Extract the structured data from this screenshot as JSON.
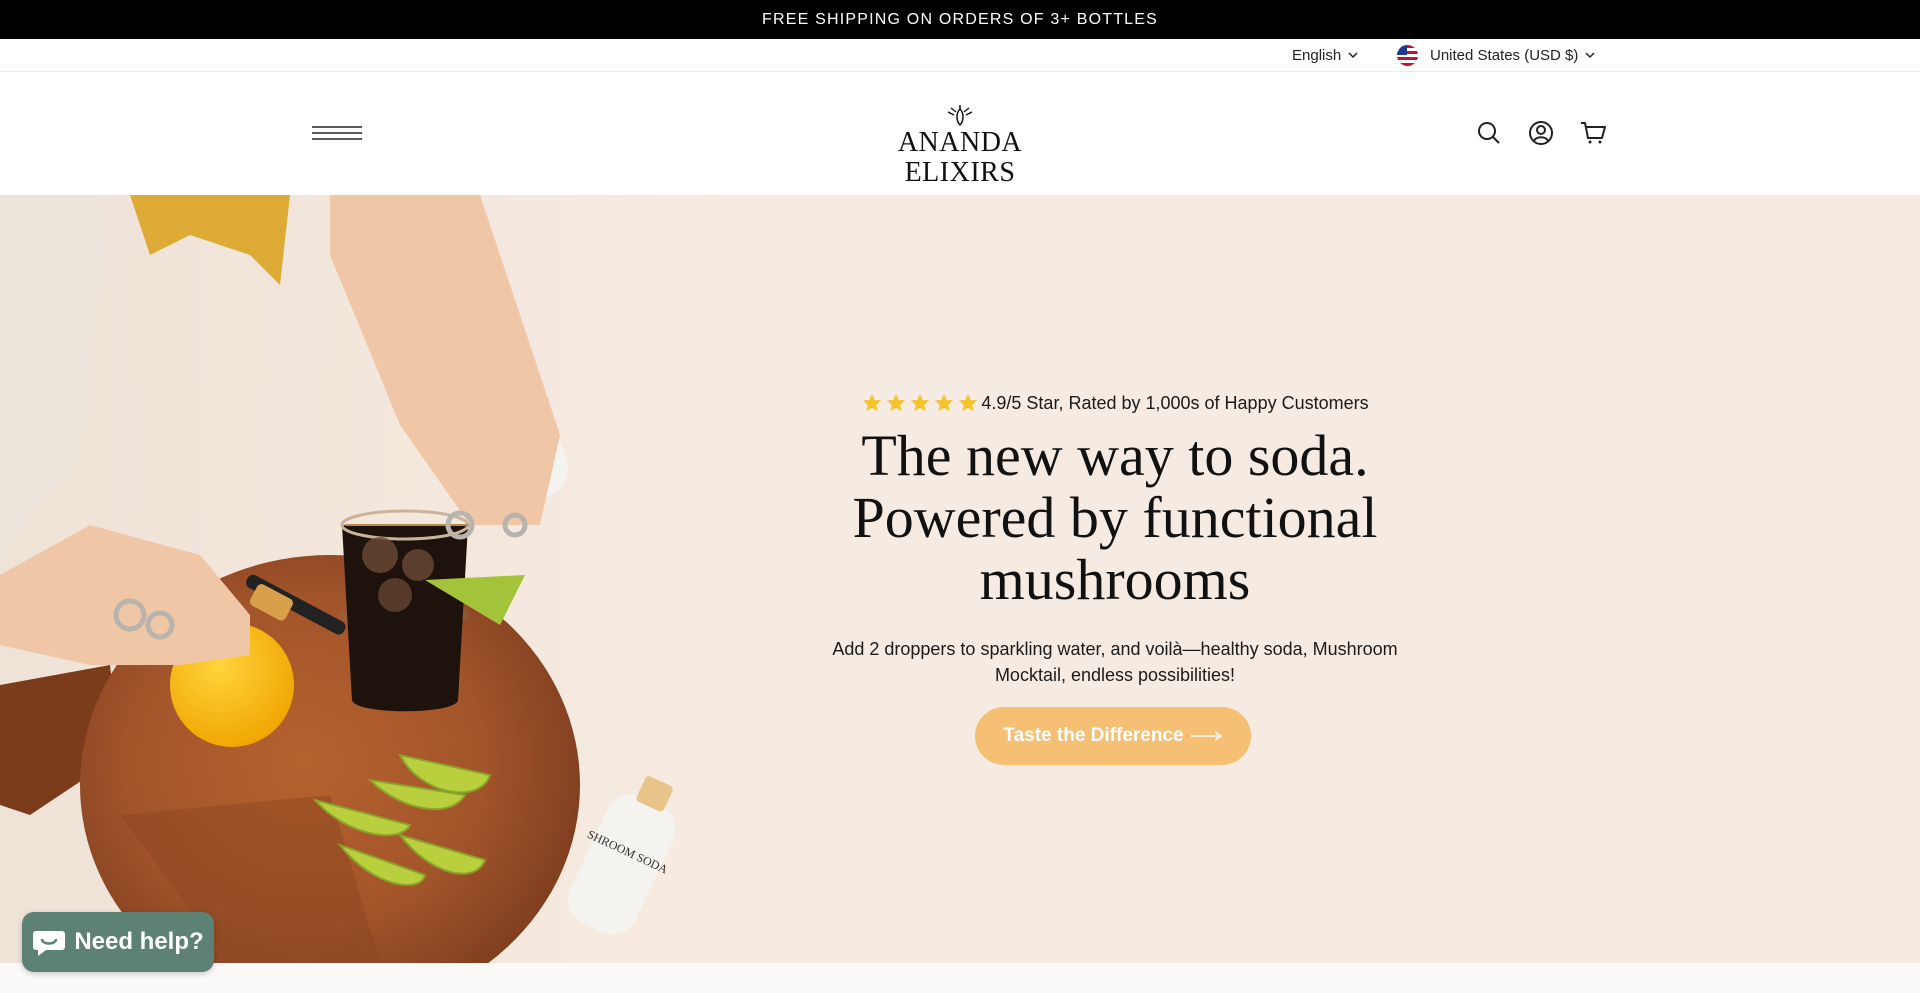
{
  "announcement": {
    "text": "FREE SHIPPING ON ORDERS OF 3+ BOTTLES"
  },
  "utility": {
    "language": "English",
    "country": "United States (USD $)"
  },
  "header": {
    "logo_text": "ANANDA ELIXIRS",
    "icons": [
      "menu-icon",
      "search-icon",
      "account-icon",
      "cart-icon"
    ]
  },
  "hero": {
    "rating": {
      "stars": 5,
      "text": "4.9/5 Star, Rated by 1,000s of Happy Customers"
    },
    "headline_lines": [
      "The new way to soda.",
      "Powered by functional",
      "mushrooms"
    ],
    "subcopy": "Add 2 droppers to sparkling water, and voilà—healthy soda, Mushroom Mocktail, endless possibilities!",
    "cta_label": "Taste the Difference",
    "bottle_label": "SHROOM SODA"
  },
  "chat": {
    "label": "Need help?"
  },
  "colors": {
    "announcement_bg": "#000000",
    "hero_bg": "#f6ebe2",
    "cta_bg": "#f5bf74",
    "star": "#f4c430",
    "chat_bg": "#5e8176"
  }
}
